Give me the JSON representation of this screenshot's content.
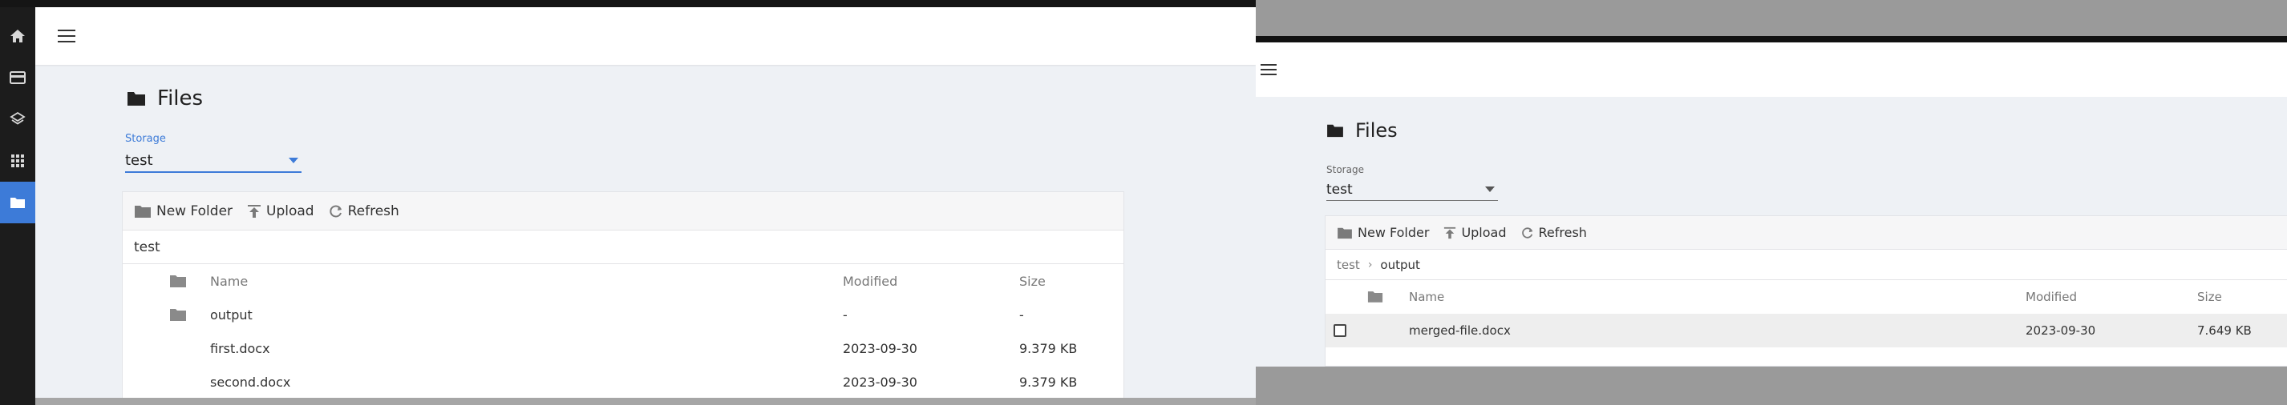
{
  "left_window": {
    "title": "Files",
    "storage": {
      "label": "Storage",
      "value": "test"
    },
    "toolbar": {
      "new_folder": "New Folder",
      "upload": "Upload",
      "refresh": "Refresh"
    },
    "breadcrumb": [
      "test"
    ],
    "table": {
      "headers": {
        "name": "Name",
        "modified": "Modified",
        "size": "Size"
      },
      "rows": [
        {
          "type": "folder",
          "name": "output",
          "modified": "-",
          "size": "-"
        },
        {
          "type": "file",
          "name": "first.docx",
          "modified": "2023-09-30",
          "size": "9.379 KB"
        },
        {
          "type": "file",
          "name": "second.docx",
          "modified": "2023-09-30",
          "size": "9.379 KB"
        }
      ]
    },
    "rail_icons": [
      "home-icon",
      "card-icon",
      "layers-icon",
      "apps-grid-icon",
      "folder-icon"
    ]
  },
  "right_window": {
    "title": "Files",
    "storage": {
      "label": "Storage",
      "value": "test"
    },
    "toolbar": {
      "new_folder": "New Folder",
      "upload": "Upload",
      "refresh": "Refresh"
    },
    "breadcrumb": [
      "test",
      "output"
    ],
    "table": {
      "headers": {
        "name": "Name",
        "modified": "Modified",
        "size": "Size"
      },
      "rows": [
        {
          "type": "file",
          "name": "merged-file.docx",
          "modified": "2023-09-30",
          "size": "7.649 KB",
          "selected": false
        }
      ]
    }
  },
  "colors": {
    "accent": "#3d7bd8",
    "rail": "#1c1c1c",
    "content_bg": "#eef1f5"
  }
}
